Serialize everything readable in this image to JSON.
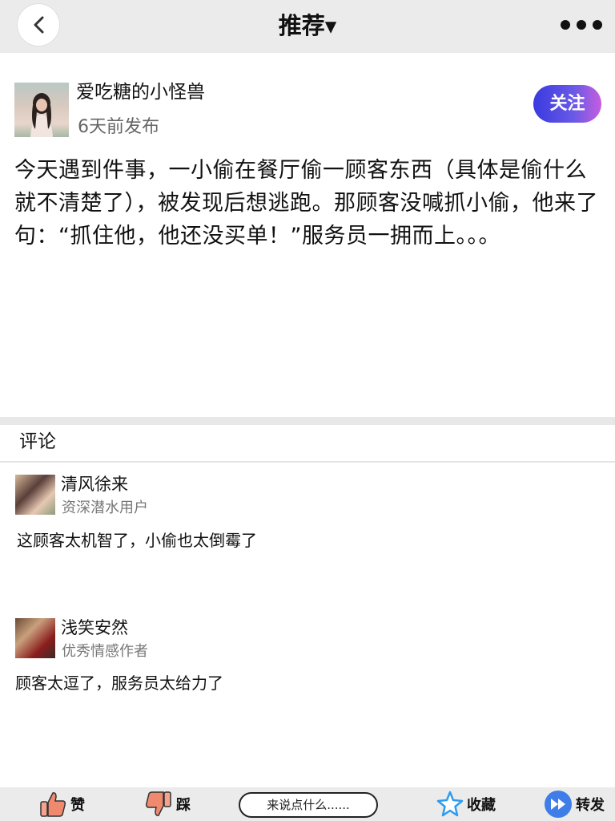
{
  "header": {
    "back_icon": "chevron-left-icon",
    "title": "推荐▾",
    "more_icon": "more-dots-icon"
  },
  "post": {
    "author_name": "爱吃糖的小怪兽",
    "time": "6天前发布",
    "follow_label": "关注",
    "body": "今天遇到件事，一小偷在餐厅偷一顾客东西（具体是偷什么就不清楚了），被发现后想逃跑。那顾客没喊抓小偷，他来了句：“抓住他，他还没买单！”服务员一拥而上。。。"
  },
  "comments": {
    "heading": "评论",
    "items": [
      {
        "name": "清风徐来",
        "badge": "资深潜水用户",
        "text": "这顾客太机智了，小偷也太倒霉了"
      },
      {
        "name": "浅笑安然",
        "badge": "优秀情感作者",
        "text": "顾客太逗了，服务员太给力了"
      }
    ]
  },
  "bottom_bar": {
    "like_label": "赞",
    "dislike_label": "踩",
    "comment_placeholder": "来说点什么......",
    "favorite_label": "收藏",
    "share_label": "转发"
  },
  "colors": {
    "follow_gradient_start": "#3a3adf",
    "follow_gradient_end": "#c65ddf",
    "like_icon": "#f08a6f",
    "star_icon": "#2f9bf0",
    "share_icon": "#3f7de8"
  }
}
